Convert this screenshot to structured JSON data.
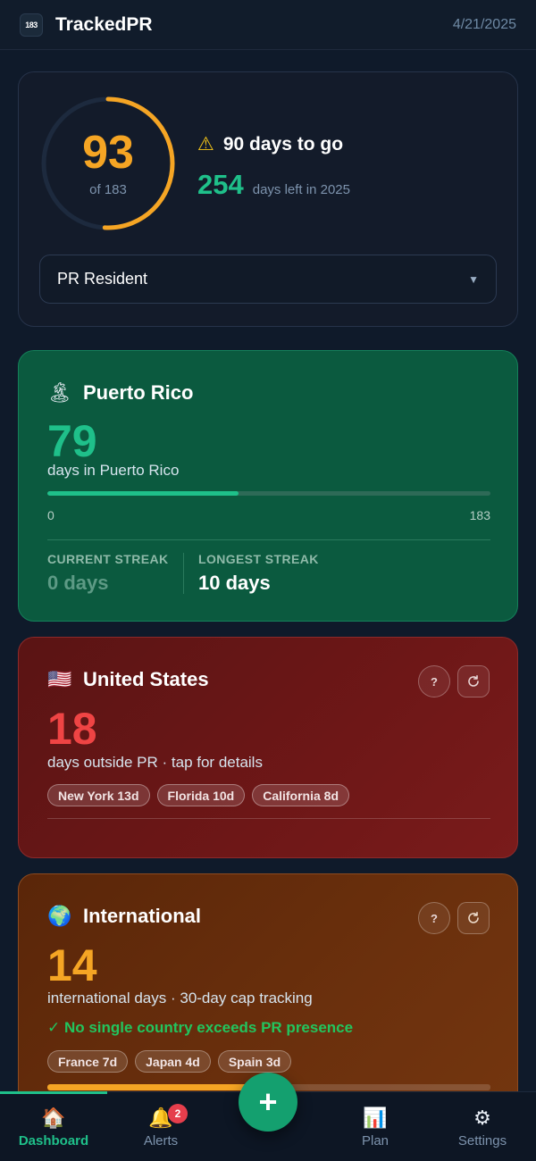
{
  "header": {
    "logo_text": "183",
    "title": "TrackedPR",
    "date": "4/21/2025"
  },
  "summary": {
    "days_count": "93",
    "of_label": "of 183",
    "progress_fraction": 0.508,
    "warning_icon": "warning-icon",
    "to_go": "90 days to go",
    "days_left": "254",
    "days_left_label": "days left in 2025",
    "status_select": "PR Resident"
  },
  "puerto_rico": {
    "flag_icon": "island-icon",
    "name": "Puerto Rico",
    "days": "79",
    "subtitle": "days in Puerto Rico",
    "progress_fraction": 0.432,
    "scale_min": "0",
    "scale_max": "183",
    "current_streak_label": "CURRENT STREAK",
    "current_streak": "0 days",
    "longest_streak_label": "LONGEST STREAK",
    "longest_streak": "10 days"
  },
  "united_states": {
    "flag_icon": "us-flag-icon",
    "name": "United States",
    "days": "18",
    "subtitle": "days outside PR · tap for details",
    "help_label": "?",
    "states": [
      "New York 13d",
      "Florida 10d",
      "California 8d"
    ]
  },
  "international": {
    "flag_icon": "globe-icon",
    "name": "International",
    "days": "14",
    "subtitle": "international days · 30-day cap tracking",
    "status": "✓ No single country exceeds PR presence",
    "help_label": "?",
    "countries": [
      "France 7d",
      "Japan 4d",
      "Spain 3d"
    ],
    "progress_fraction": 0.47
  },
  "nav": {
    "dashboard": "Dashboard",
    "alerts": "Alerts",
    "alerts_badge": "2",
    "add": "+",
    "plan": "Plan",
    "settings": "Settings"
  },
  "colors": {
    "accent_green": "#1fc08a",
    "accent_orange": "#f5a524",
    "accent_red": "#ef4444",
    "background": "#0f1a2a"
  }
}
